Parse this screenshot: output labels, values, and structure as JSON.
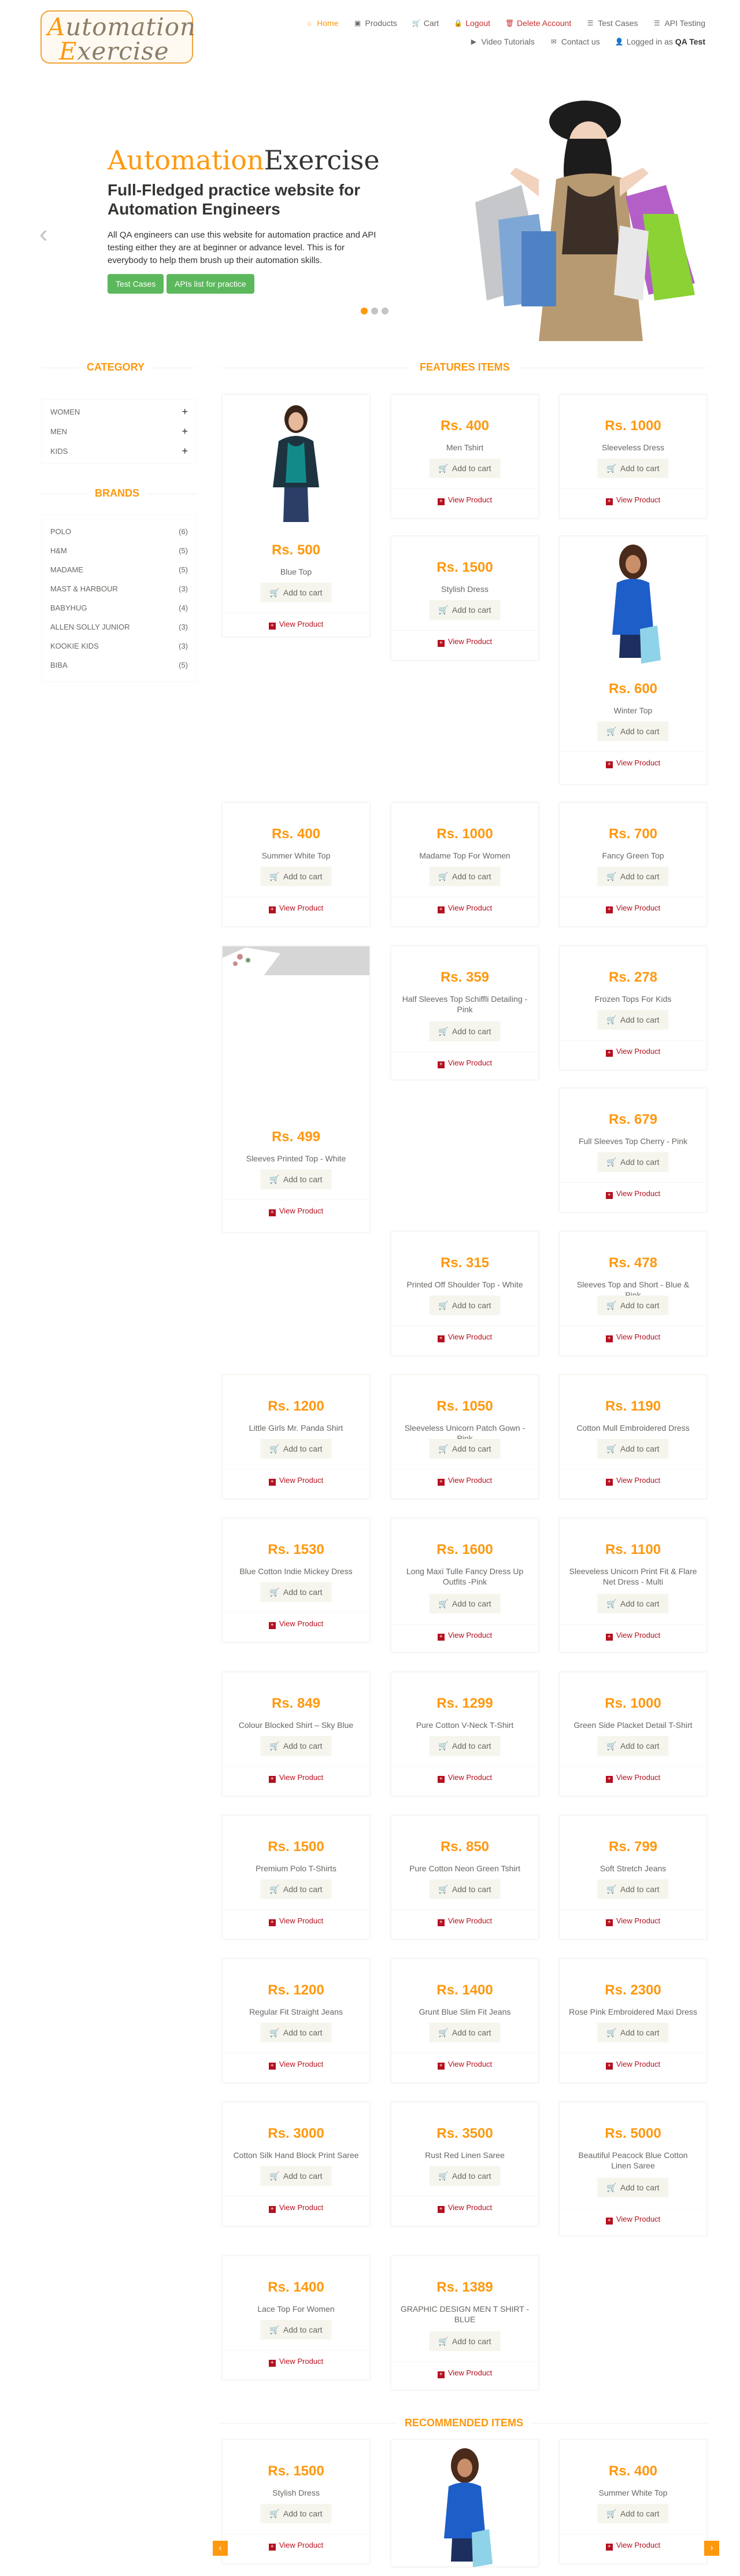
{
  "header": {
    "logo_line1": "Automation",
    "logo_line2": "Exercise",
    "nav": [
      {
        "label": "Home",
        "icon": "home-icon",
        "glyph": "⌂"
      },
      {
        "label": "Products",
        "icon": "products-icon",
        "glyph": "▣"
      },
      {
        "label": "Cart",
        "icon": "cart-icon",
        "glyph": "🛒"
      },
      {
        "label": "Logout",
        "icon": "lock-icon",
        "glyph": "🔒"
      },
      {
        "label": "Delete Account",
        "icon": "trash-icon",
        "glyph": "🗑"
      },
      {
        "label": "Test Cases",
        "icon": "list-icon",
        "glyph": "☰"
      },
      {
        "label": "API Testing",
        "icon": "list-icon",
        "glyph": "☰"
      },
      {
        "label": "Video Tutorials",
        "icon": "youtube-icon",
        "glyph": "▶"
      },
      {
        "label": "Contact us",
        "icon": "envelope-icon",
        "glyph": "✉"
      },
      {
        "label": "Logged in as",
        "icon": "user-icon",
        "glyph": "👤",
        "user": "QA Test"
      }
    ]
  },
  "slider": {
    "brand_a": "Automation",
    "brand_b": "Exercise",
    "heading": "Full-Fledged practice website for Automation Engineers",
    "text": "All QA engineers can use this website for automation practice and API testing either they are at beginner or advance level. This is for everybody to help them brush up their automation skills.",
    "btn_test_cases": "Test Cases",
    "btn_apis": "APIs list for practice",
    "prev": "‹",
    "next": "›"
  },
  "sidebar": {
    "category_title": "Category",
    "categories": [
      "Women",
      "Men",
      "Kids"
    ],
    "brands_title": "Brands",
    "brands": [
      {
        "name": "Polo",
        "count": "(6)"
      },
      {
        "name": "H&M",
        "count": "(5)"
      },
      {
        "name": "Madame",
        "count": "(5)"
      },
      {
        "name": "Mast & Harbour",
        "count": "(3)"
      },
      {
        "name": "Babyhug",
        "count": "(4)"
      },
      {
        "name": "Allen Solly Junior",
        "count": "(3)"
      },
      {
        "name": "Kookie Kids",
        "count": "(3)"
      },
      {
        "name": "Biba",
        "count": "(5)"
      }
    ]
  },
  "features_title": "Features Items",
  "recommended_title": "Recommended Items",
  "labels": {
    "add_to_cart": "Add to cart",
    "view_product": "View Product"
  },
  "products": [
    {
      "price": "Rs. 500",
      "name": "Blue Top"
    },
    {
      "price": "Rs. 400",
      "name": "Men Tshirt"
    },
    {
      "price": "Rs. 1000",
      "name": "Sleeveless Dress"
    },
    {
      "price": "Rs. 1500",
      "name": "Stylish Dress"
    },
    {
      "price": "Rs. 600",
      "name": "Winter Top"
    },
    {
      "price": "Rs. 400",
      "name": "Summer White Top"
    },
    {
      "price": "Rs. 1000",
      "name": "Madame Top For Women"
    },
    {
      "price": "Rs. 700",
      "name": "Fancy Green Top"
    },
    {
      "price": "Rs. 499",
      "name": "Sleeves Printed Top - White"
    },
    {
      "price": "Rs. 359",
      "name": "Half Sleeves Top Schiffli Detailing - Pink"
    },
    {
      "price": "Rs. 278",
      "name": "Frozen Tops For Kids"
    },
    {
      "price": "Rs. 679",
      "name": "Full Sleeves Top Cherry - Pink"
    },
    {
      "price": "Rs. 315",
      "name": "Printed Off Shoulder Top - White"
    },
    {
      "price": "Rs. 478",
      "name": "Sleeves Top and Short - Blue & Pink"
    },
    {
      "price": "Rs. 1200",
      "name": "Little Girls Mr. Panda Shirt"
    },
    {
      "price": "Rs. 1050",
      "name": "Sleeveless Unicorn Patch Gown - Pink"
    },
    {
      "price": "Rs. 1190",
      "name": "Cotton Mull Embroidered Dress"
    },
    {
      "price": "Rs. 1530",
      "name": "Blue Cotton Indie Mickey Dress"
    },
    {
      "price": "Rs. 1600",
      "name": "Long Maxi Tulle Fancy Dress Up Outfits -Pink"
    },
    {
      "price": "Rs. 1100",
      "name": "Sleeveless Unicorn Print Fit & Flare Net Dress - Multi"
    },
    {
      "price": "Rs. 849",
      "name": "Colour Blocked Shirt – Sky Blue"
    },
    {
      "price": "Rs. 1299",
      "name": "Pure Cotton V-Neck T-Shirt"
    },
    {
      "price": "Rs. 1000",
      "name": "Green Side Placket Detail T-Shirt"
    },
    {
      "price": "Rs. 1500",
      "name": "Premium Polo T-Shirts"
    },
    {
      "price": "Rs. 850",
      "name": "Pure Cotton Neon Green Tshirt"
    },
    {
      "price": "Rs. 799",
      "name": "Soft Stretch Jeans"
    },
    {
      "price": "Rs. 1200",
      "name": "Regular Fit Straight Jeans"
    },
    {
      "price": "Rs. 1400",
      "name": "Grunt Blue Slim Fit Jeans"
    },
    {
      "price": "Rs. 2300",
      "name": "Rose Pink Embroidered Maxi Dress"
    },
    {
      "price": "Rs. 3000",
      "name": "Cotton Silk Hand Block Print Saree"
    },
    {
      "price": "Rs. 3500",
      "name": "Rust Red Linen Saree"
    },
    {
      "price": "Rs. 5000",
      "name": "Beautiful Peacock Blue Cotton Linen Saree"
    },
    {
      "price": "Rs. 1400",
      "name": "Lace Top For Women"
    },
    {
      "price": "Rs. 1389",
      "name": "GRAPHIC DESIGN MEN T SHIRT - BLUE"
    }
  ],
  "recommended": [
    {
      "price": "Rs. 1500",
      "name": "Stylish Dress"
    },
    {
      "price": "Rs. 400",
      "name": "Summer White Top"
    }
  ],
  "carousel": {
    "prev": "‹",
    "next": "›"
  }
}
